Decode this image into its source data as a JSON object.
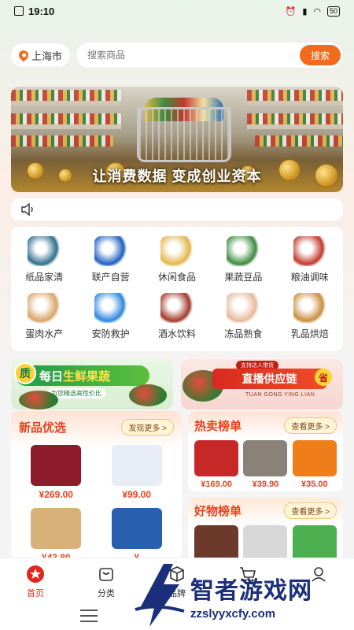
{
  "status_bar": {
    "time": "19:10",
    "battery": "50"
  },
  "location": {
    "city": "上海市"
  },
  "search": {
    "placeholder": "搜索商品",
    "button_label": "搜索"
  },
  "banner": {
    "slogan": "让消费数据 变成创业资本"
  },
  "categories": [
    {
      "label": "纸品家清",
      "icon": "tissue-icon",
      "color": "#2f6f8f"
    },
    {
      "label": "联产自营",
      "icon": "oem-icon",
      "color": "#1f5fbf"
    },
    {
      "label": "休闲食品",
      "icon": "snacks-icon",
      "color": "#e2b64c"
    },
    {
      "label": "果蔬豆品",
      "icon": "vegetables-icon",
      "color": "#3d8b40"
    },
    {
      "label": "粮油调味",
      "icon": "oil-seasoning-icon",
      "color": "#c0392b"
    },
    {
      "label": "蛋肉水产",
      "icon": "eggs-icon",
      "color": "#d9a46a"
    },
    {
      "label": "安防救护",
      "icon": "shield-icon",
      "color": "#2e86de"
    },
    {
      "label": "酒水饮料",
      "icon": "wine-icon",
      "color": "#a33a2b"
    },
    {
      "label": "冻品熟食",
      "icon": "chicken-icon",
      "color": "#e8b99a"
    },
    {
      "label": "乳品烘焙",
      "icon": "bread-icon",
      "color": "#c98f3c"
    }
  ],
  "promos": {
    "left": {
      "badge": "质",
      "title_a": "每日",
      "title_b": "生鲜果蔬",
      "subtitle": "为您精选高性价比"
    },
    "right": {
      "tag": "支持达人带货",
      "title": "直播供应链",
      "badge": "省",
      "subtitle": "TUAN GONG YING LIAN"
    }
  },
  "new_products": {
    "title": "新品优选",
    "more_label": "发现更多 >",
    "items": [
      {
        "price": "¥269.00",
        "color": "#8e1b2a"
      },
      {
        "price": "¥99.00",
        "color": "#e9eef6"
      },
      {
        "price": "¥43.80",
        "color": "#d8b07a"
      },
      {
        "price": "¥",
        "color": "#2a5fb0"
      }
    ]
  },
  "hot_list": {
    "title": "热卖榜单",
    "more_label": "查看更多 >",
    "items": [
      {
        "price": "¥169.00",
        "color": "#c62828"
      },
      {
        "price": "¥39.90",
        "color": "#8a8178"
      },
      {
        "price": "¥35.00",
        "color": "#ef7d1a"
      }
    ]
  },
  "good_list": {
    "title": "好物榜单",
    "more_label": "查看更多 >",
    "items": [
      {
        "color": "#6b3a2a"
      },
      {
        "color": "#d8d8d8"
      },
      {
        "color": "#4caf50"
      }
    ]
  },
  "tabbar": {
    "items": [
      {
        "label": "首页",
        "active": true
      },
      {
        "label": "分类"
      },
      {
        "label": "品牌"
      },
      {
        "label": ""
      },
      {
        "label": ""
      }
    ]
  },
  "watermark": {
    "title": "智者游戏网",
    "url": "zzslyyxcfy.com"
  },
  "colors": {
    "accent": "#f26b1d",
    "price_red": "#e8431f",
    "active_tab": "#e3261b"
  }
}
